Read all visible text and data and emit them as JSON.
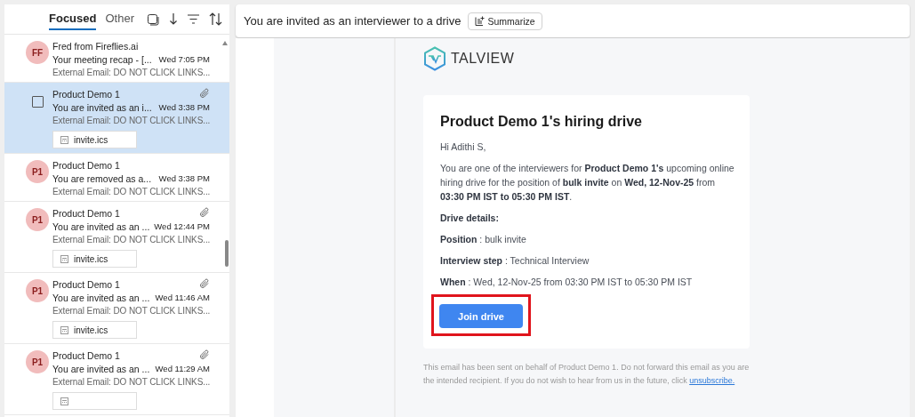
{
  "mail_list": {
    "tabs": [
      {
        "label": "Focused",
        "selected": true
      },
      {
        "label": "Other",
        "selected": false
      }
    ],
    "messages": [
      {
        "initials": "FF",
        "sender": "Fred from Fireflies.ai",
        "subject": "Your meeting recap - [...",
        "time": "Wed 7:05 PM",
        "preview": "External Email: DO NOT CLICK LINKS...",
        "has_attachment": false,
        "selected": false
      },
      {
        "sender": "Product Demo 1",
        "subject": "You are invited as an i...",
        "time": "Wed 3:38 PM",
        "preview": "External Email: DO NOT CLICK LINKS...",
        "has_attachment": true,
        "attachment": "invite.ics",
        "selected": true
      },
      {
        "initials": "P1",
        "sender": "Product Demo 1",
        "subject": "You are removed as a...",
        "time": "Wed 3:38 PM",
        "preview": "External Email: DO NOT CLICK LINKS...",
        "has_attachment": false,
        "selected": false
      },
      {
        "initials": "P1",
        "sender": "Product Demo 1",
        "subject": "You are invited as an ...",
        "time": "Wed 12:44 PM",
        "preview": "External Email: DO NOT CLICK LINKS...",
        "has_attachment": true,
        "attachment": "invite.ics",
        "selected": false
      },
      {
        "initials": "P1",
        "sender": "Product Demo 1",
        "subject": "You are invited as an ...",
        "time": "Wed 11:46 AM",
        "preview": "External Email: DO NOT CLICK LINKS...",
        "has_attachment": true,
        "attachment": "invite.ics",
        "selected": false
      },
      {
        "initials": "P1",
        "sender": "Product Demo 1",
        "subject": "You are invited as an ...",
        "time": "Wed 11:29 AM",
        "preview": "External Email: DO NOT CLICK LINKS...",
        "has_attachment": true,
        "selected": false
      }
    ]
  },
  "reading_pane": {
    "subject": "You are invited as an interviewer to a drive",
    "summarize_button": "Summarize",
    "email": {
      "logo_text": "TALVIEW",
      "heading": "Product Demo 1's hiring drive",
      "greeting": "Hi Adithi S,",
      "intro": "You are one of the interviewers for **Product Demo 1's** upcoming online hiring drive for the position of **bulk invite** on **Wed, 12-Nov-25** from **03:30 PM IST to 05:30 PM IST**.",
      "section_title": "Drive details:",
      "details": [
        "**Position** : bulk invite",
        "**Interview step** : Technical Interview",
        "**When** : Wed, 12-Nov-25 from 03:30 PM IST to 05:30 PM IST"
      ],
      "button": {
        "label": "Join drive",
        "highlighted": true
      },
      "footer": "This email has been sent on behalf of Product Demo 1. Do not forward this email as you are the intended recipient. If you do not wish to hear from us in the future, click",
      "footer_link": "unsubscribe."
    }
  }
}
